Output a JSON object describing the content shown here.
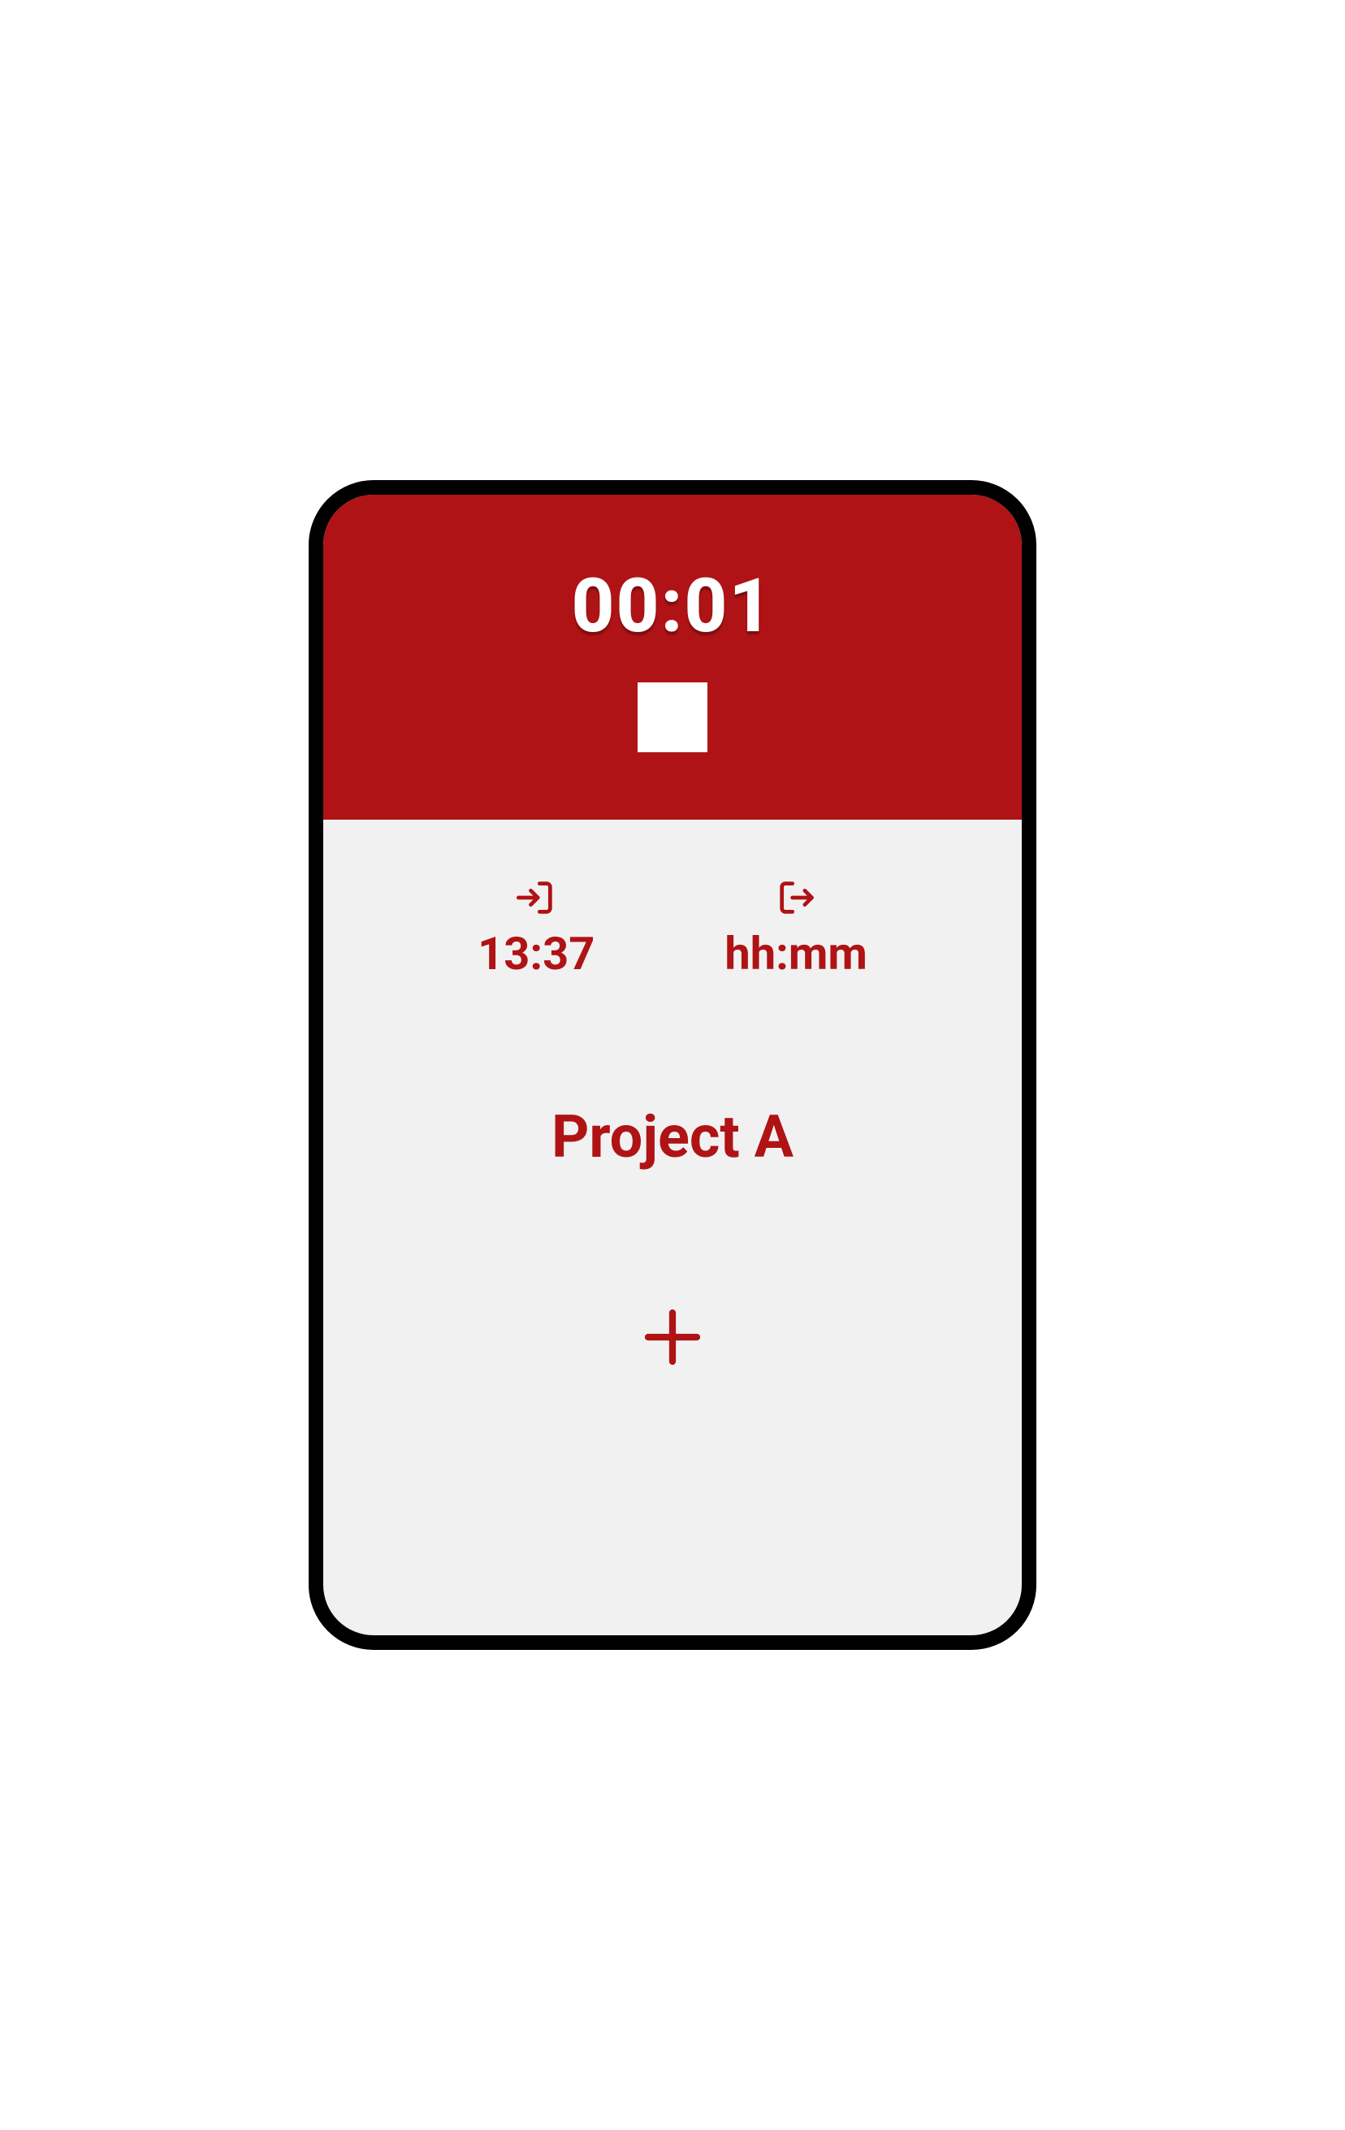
{
  "colors": {
    "primary": "#af1315",
    "background": "#f1f1f1",
    "frame": "#000000",
    "onPrimary": "#ffffff"
  },
  "header": {
    "timer": "00:01",
    "action_icon": "stop-icon"
  },
  "times": {
    "in_icon": "login-icon",
    "in_value": "13:37",
    "out_icon": "logout-icon",
    "out_value": "hh:mm"
  },
  "project": {
    "name": "Project A"
  },
  "actions": {
    "add_icon": "plus-icon"
  }
}
